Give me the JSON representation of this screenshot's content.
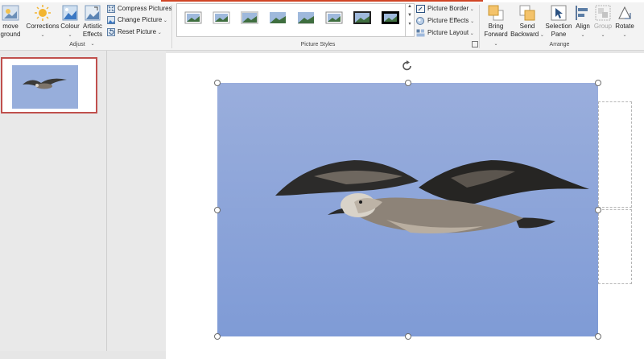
{
  "ribbon": {
    "adjust": {
      "remove_background_line1": "move",
      "remove_background_line2": "ground",
      "corrections_label": "Corrections",
      "colour_label": "Colour",
      "artistic_effects_line1": "Artistic",
      "artistic_effects_line2": "Effects",
      "compress_pictures_label": "Compress Pictures",
      "change_picture_label": "Change Picture",
      "reset_picture_label": "Reset Picture",
      "group_label": "Adjust"
    },
    "picture_styles": {
      "picture_border_label": "Picture Border",
      "picture_effects_label": "Picture Effects",
      "picture_layout_label": "Picture Layout",
      "group_label": "Picture Styles"
    },
    "arrange": {
      "bring_forward_line1": "Bring",
      "bring_forward_line2": "Forward",
      "send_backward_line1": "Send",
      "send_backward_line2": "Backward",
      "selection_pane_line1": "Selection",
      "selection_pane_line2": "Pane",
      "align_label": "Align",
      "group_button_label": "Group",
      "rotate_label": "Rotate",
      "group_label": "Arrange"
    }
  },
  "colors": {
    "accent": "#d04525",
    "thumbnail_selection": "#c0504d",
    "sky": "#8ea6d6"
  }
}
